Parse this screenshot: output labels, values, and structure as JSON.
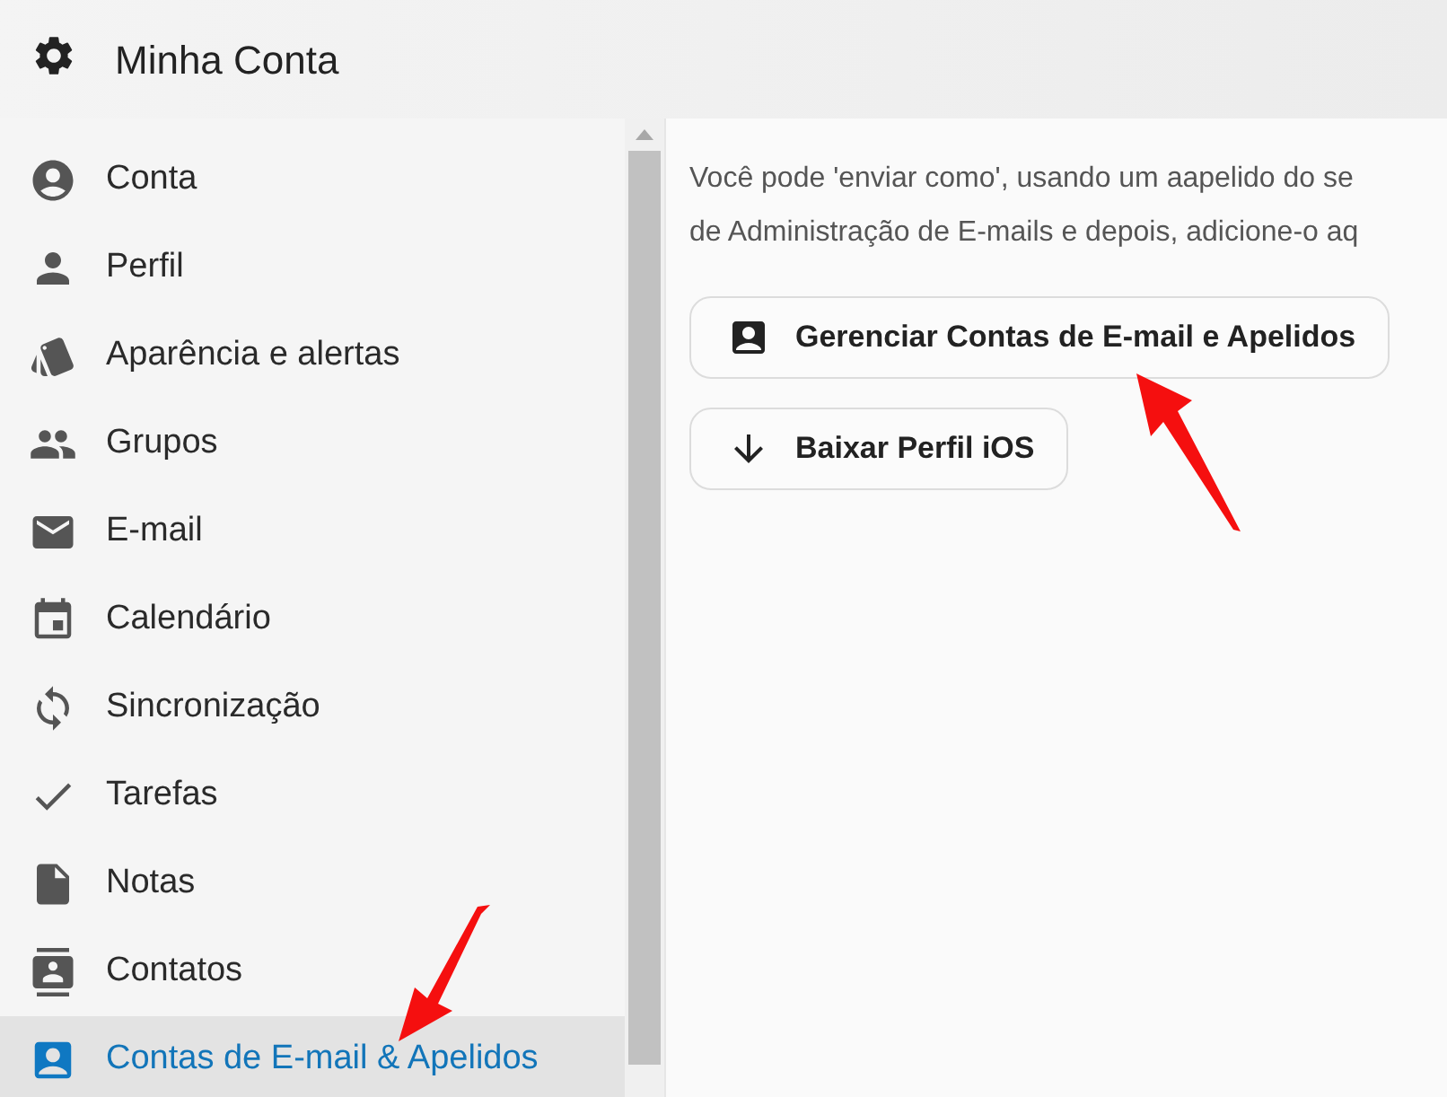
{
  "header": {
    "title": "Minha Conta"
  },
  "sidebar": {
    "items": [
      {
        "label": "Conta",
        "selected": false
      },
      {
        "label": "Perfil",
        "selected": false
      },
      {
        "label": "Aparência e alertas",
        "selected": false
      },
      {
        "label": "Grupos",
        "selected": false
      },
      {
        "label": "E-mail",
        "selected": false
      },
      {
        "label": "Calendário",
        "selected": false
      },
      {
        "label": "Sincronização",
        "selected": false
      },
      {
        "label": "Tarefas",
        "selected": false
      },
      {
        "label": "Notas",
        "selected": false
      },
      {
        "label": "Contatos",
        "selected": false
      },
      {
        "label": "Contas de E-mail & Apelidos",
        "selected": true
      }
    ]
  },
  "content": {
    "lines": [
      "Você pode 'enviar como', usando um aapelido do se",
      "de Administração de E-mails e depois, adicione-o aq"
    ],
    "buttons": [
      "Gerenciar Contas de E-mail e Apelidos",
      "Baixar Perfil iOS"
    ]
  }
}
